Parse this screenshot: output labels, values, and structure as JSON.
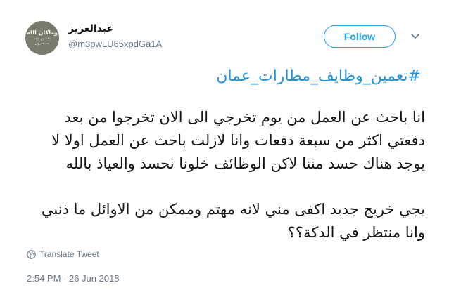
{
  "author": {
    "display_name": "عبدالعزيز",
    "handle": "@m3pwLU65xpdGa1A",
    "avatar_text": [
      "وماكان الله",
      "معذبهم وهم",
      "يستغفرون"
    ]
  },
  "header": {
    "follow_label": "Follow",
    "menu_icon": "chevron-down-icon"
  },
  "tweet": {
    "hashtag": "#تعمين_وظايف_مطارات_عمان",
    "paragraph1": [
      "انا باحث عن العمل من يوم تخرجي الى الان تخرجوا من بعد",
      "دفعتي اكثر من سبعة دفعات وانا لازلت باحث عن العمل اولا لا",
      "يوجد هناك حسد مننا لاكن الوظائف خلونا نحسد والعياذ بالله"
    ],
    "paragraph2": [
      "يجي خريج جديد اكفى مني لانه مهتم وممكن من الاوائل ما ذنبي",
      "وانا منتظر في الدكة؟؟"
    ]
  },
  "translate_label": "Translate Tweet",
  "timestamp": "2:54 PM - 26 Jun 2018",
  "colors": {
    "accent": "#1da1f2",
    "link": "#1b95e0",
    "secondary_text": "#657786"
  }
}
